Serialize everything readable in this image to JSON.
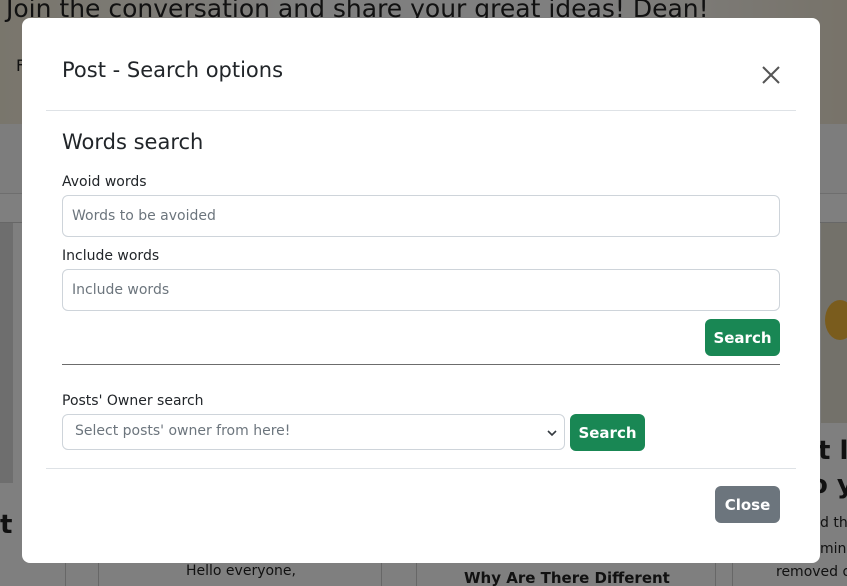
{
  "background": {
    "hero_title": "Join the conversation and share your great ideas! Dean!",
    "hero_letter": "F",
    "card_heading_fragment_1": "t",
    "card_heading_fragment_2": "o y",
    "card_heading_fragment_3": "t l",
    "card_body_1": "Hello everyone,",
    "card_body_2": "Why Are There Different",
    "card_body_3": "d th",
    "card_body_4": "min",
    "card_body_5": "removed o"
  },
  "modal": {
    "title": "Post - Search options",
    "close_icon": "close-icon",
    "words_section_title": "Words search",
    "avoid_label": "Avoid words",
    "avoid_placeholder": "Words to be avoided",
    "include_label": "Include words",
    "include_placeholder": "Include words",
    "words_search_button": "Search",
    "owner_label": "Posts' Owner search",
    "owner_select_value": "Select posts' owner from here!",
    "owner_search_button": "Search",
    "close_button": "Close"
  },
  "colors": {
    "success": "#198754",
    "secondary": "#6c757d",
    "overlay": "rgba(0,0,0,0.5)"
  }
}
